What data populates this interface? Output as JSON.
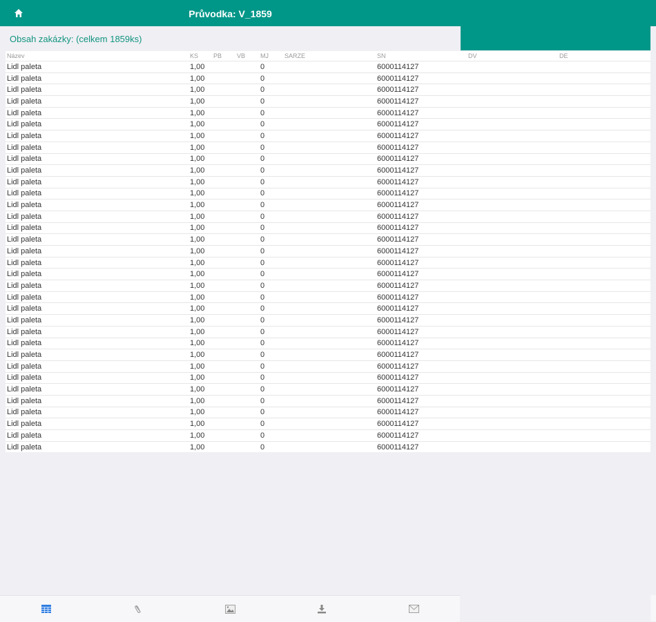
{
  "header": {
    "title": "Průvodka: V_1859",
    "home_icon": "home-icon"
  },
  "subtitle": "Obsah zakázky: (celkem 1859ks)",
  "table": {
    "columns": [
      "Název",
      "KS",
      "PB",
      "VB",
      "MJ",
      "SARZE",
      "SN",
      "DV",
      "DE"
    ],
    "rows": [
      [
        "Lidl paleta",
        "1,00",
        "",
        "",
        "0",
        "",
        "6000114127",
        "",
        ""
      ],
      [
        "Lidl paleta",
        "1,00",
        "",
        "",
        "0",
        "",
        "6000114127",
        "",
        ""
      ],
      [
        "Lidl paleta",
        "1,00",
        "",
        "",
        "0",
        "",
        "6000114127",
        "",
        ""
      ],
      [
        "Lidl paleta",
        "1,00",
        "",
        "",
        "0",
        "",
        "6000114127",
        "",
        ""
      ],
      [
        "Lidl paleta",
        "1,00",
        "",
        "",
        "0",
        "",
        "6000114127",
        "",
        ""
      ],
      [
        "Lidl paleta",
        "1,00",
        "",
        "",
        "0",
        "",
        "6000114127",
        "",
        ""
      ],
      [
        "Lidl paleta",
        "1,00",
        "",
        "",
        "0",
        "",
        "6000114127",
        "",
        ""
      ],
      [
        "Lidl paleta",
        "1,00",
        "",
        "",
        "0",
        "",
        "6000114127",
        "",
        ""
      ],
      [
        "Lidl paleta",
        "1,00",
        "",
        "",
        "0",
        "",
        "6000114127",
        "",
        ""
      ],
      [
        "Lidl paleta",
        "1,00",
        "",
        "",
        "0",
        "",
        "6000114127",
        "",
        ""
      ],
      [
        "Lidl paleta",
        "1,00",
        "",
        "",
        "0",
        "",
        "6000114127",
        "",
        ""
      ],
      [
        "Lidl paleta",
        "1,00",
        "",
        "",
        "0",
        "",
        "6000114127",
        "",
        ""
      ],
      [
        "Lidl paleta",
        "1,00",
        "",
        "",
        "0",
        "",
        "6000114127",
        "",
        ""
      ],
      [
        "Lidl paleta",
        "1,00",
        "",
        "",
        "0",
        "",
        "6000114127",
        "",
        ""
      ],
      [
        "Lidl paleta",
        "1,00",
        "",
        "",
        "0",
        "",
        "6000114127",
        "",
        ""
      ],
      [
        "Lidl paleta",
        "1,00",
        "",
        "",
        "0",
        "",
        "6000114127",
        "",
        ""
      ],
      [
        "Lidl paleta",
        "1,00",
        "",
        "",
        "0",
        "",
        "6000114127",
        "",
        ""
      ],
      [
        "Lidl paleta",
        "1,00",
        "",
        "",
        "0",
        "",
        "6000114127",
        "",
        ""
      ],
      [
        "Lidl paleta",
        "1,00",
        "",
        "",
        "0",
        "",
        "6000114127",
        "",
        ""
      ],
      [
        "Lidl paleta",
        "1,00",
        "",
        "",
        "0",
        "",
        "6000114127",
        "",
        ""
      ],
      [
        "Lidl paleta",
        "1,00",
        "",
        "",
        "0",
        "",
        "6000114127",
        "",
        ""
      ],
      [
        "Lidl paleta",
        "1,00",
        "",
        "",
        "0",
        "",
        "6000114127",
        "",
        ""
      ],
      [
        "Lidl paleta",
        "1,00",
        "",
        "",
        "0",
        "",
        "6000114127",
        "",
        ""
      ],
      [
        "Lidl paleta",
        "1,00",
        "",
        "",
        "0",
        "",
        "6000114127",
        "",
        ""
      ],
      [
        "Lidl paleta",
        "1,00",
        "",
        "",
        "0",
        "",
        "6000114127",
        "",
        ""
      ],
      [
        "Lidl paleta",
        "1,00",
        "",
        "",
        "0",
        "",
        "6000114127",
        "",
        ""
      ],
      [
        "Lidl paleta",
        "1,00",
        "",
        "",
        "0",
        "",
        "6000114127",
        "",
        ""
      ],
      [
        "Lidl paleta",
        "1,00",
        "",
        "",
        "0",
        "",
        "6000114127",
        "",
        ""
      ],
      [
        "Lidl paleta",
        "1,00",
        "",
        "",
        "0",
        "",
        "6000114127",
        "",
        ""
      ],
      [
        "Lidl paleta",
        "1,00",
        "",
        "",
        "0",
        "",
        "6000114127",
        "",
        ""
      ],
      [
        "Lidl paleta",
        "1,00",
        "",
        "",
        "0",
        "",
        "6000114127",
        "",
        ""
      ],
      [
        "Lidl paleta",
        "1,00",
        "",
        "",
        "0",
        "",
        "6000114127",
        "",
        ""
      ],
      [
        "Lidl paleta",
        "1,00",
        "",
        "",
        "0",
        "",
        "6000114127",
        "",
        ""
      ],
      [
        "Lidl paleta",
        "1,00",
        "",
        "",
        "0",
        "",
        "6000114127",
        "",
        ""
      ]
    ]
  },
  "tabbar": {
    "tabs": [
      "table-icon",
      "paperclip-icon",
      "image-icon",
      "download-icon",
      "envelope-icon"
    ],
    "active": "table-icon"
  },
  "colors": {
    "accent": "#009688",
    "active_tab": "#2f7de1",
    "inactive_tab": "#a0a0a0"
  }
}
